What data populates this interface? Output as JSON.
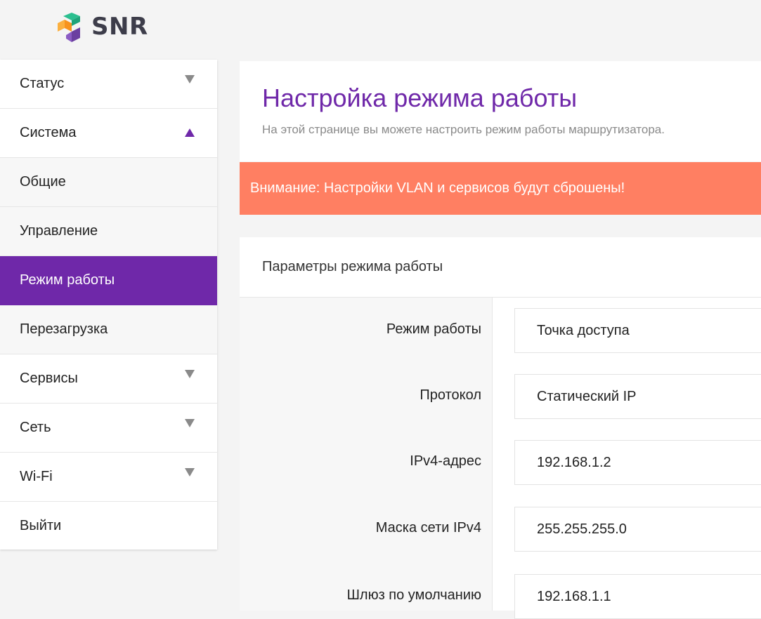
{
  "brand": {
    "name": "SNR",
    "colors": {
      "orange": "#f7931e",
      "green": "#1fa37a",
      "purple": "#6b3fa0"
    }
  },
  "sidebar": {
    "items": [
      {
        "label": "Статус",
        "icon": "chevron-down-icon"
      },
      {
        "label": "Система",
        "icon": "chevron-up-icon"
      },
      {
        "label": "Общие"
      },
      {
        "label": "Управление"
      },
      {
        "label": "Режим работы",
        "active": true
      },
      {
        "label": "Перезагрузка"
      },
      {
        "label": "Сервисы",
        "icon": "chevron-down-icon"
      },
      {
        "label": "Сеть",
        "icon": "chevron-down-icon"
      },
      {
        "label": "Wi-Fi",
        "icon": "chevron-down-icon"
      },
      {
        "label": "Выйти"
      }
    ]
  },
  "page": {
    "title": "Настройка режима работы",
    "subtitle": "На этой странице вы можете настроить режим работы маршрутизатора."
  },
  "alert": {
    "text": "Внимание: Настройки VLAN и сервисов будут сброшены!",
    "color": "#ff7f62"
  },
  "form": {
    "section_title": "Параметры режима работы",
    "fields": [
      {
        "label": "Режим работы",
        "value": "Точка доступа"
      },
      {
        "label": "Протокол",
        "value": "Статический IP"
      },
      {
        "label": "IPv4-адрес",
        "value": "192.168.1.2"
      },
      {
        "label": "Маска сети IPv4",
        "value": "255.255.255.0"
      },
      {
        "label": "Шлюз по умолчанию",
        "value": "192.168.1.1"
      }
    ]
  },
  "theme": {
    "accent": "#6f28a9"
  }
}
